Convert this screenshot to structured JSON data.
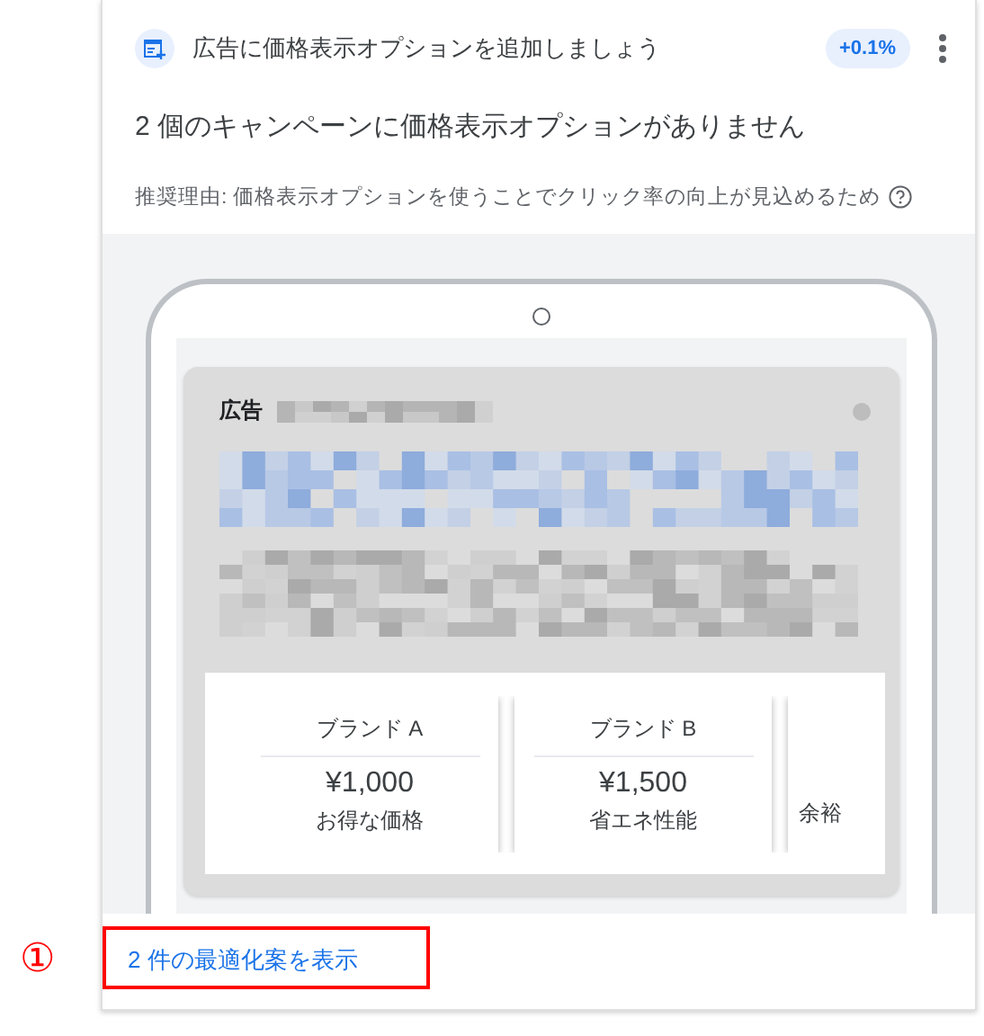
{
  "recommendation": {
    "title": "広告に価格表示オプションを追加しましょう",
    "badge": "+0.1%",
    "headline": "2 個のキャンペーンに価格表示オプションがありません",
    "reason": "推奨理由: 価格表示オプションを使うことでクリック率の向上が見込めるため"
  },
  "ad_preview": {
    "ad_label": "広告",
    "price_cards": [
      {
        "title": "ブランド A",
        "price": "¥1,000",
        "description": "お得な価格"
      },
      {
        "title": "ブランド B",
        "price": "¥1,500",
        "description": "省エネ性能"
      },
      {
        "description": "余裕"
      }
    ]
  },
  "action_link": "2 件の最適化案を表示",
  "annotation": {
    "marker": "①"
  }
}
